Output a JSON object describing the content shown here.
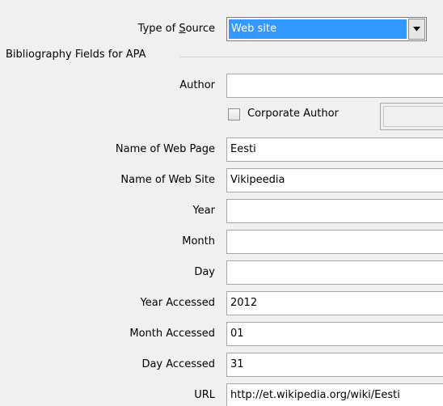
{
  "type_of_source": {
    "label_prefix": "Type of ",
    "label_accel": "S",
    "label_rest": "ource",
    "value": "Web site"
  },
  "section_title": "Bibliography Fields for APA",
  "author": {
    "label": "Author",
    "value": ""
  },
  "corporate_author": {
    "label": "Corporate Author",
    "checked": false,
    "value": ""
  },
  "fields": {
    "name_of_web_page": {
      "label": "Name of Web Page",
      "value": "Eesti"
    },
    "name_of_web_site": {
      "label": "Name of Web Site",
      "value": "Vikipeedia"
    },
    "year": {
      "label": "Year",
      "value": ""
    },
    "month": {
      "label": "Month",
      "value": ""
    },
    "day": {
      "label": "Day",
      "value": ""
    },
    "year_accessed": {
      "label": "Year Accessed",
      "value": "2012"
    },
    "month_accessed": {
      "label": "Month Accessed",
      "value": "01"
    },
    "day_accessed": {
      "label": "Day Accessed",
      "value": "31"
    },
    "url": {
      "label": "URL",
      "value": "http://et.wikipedia.org/wiki/Eesti"
    }
  }
}
